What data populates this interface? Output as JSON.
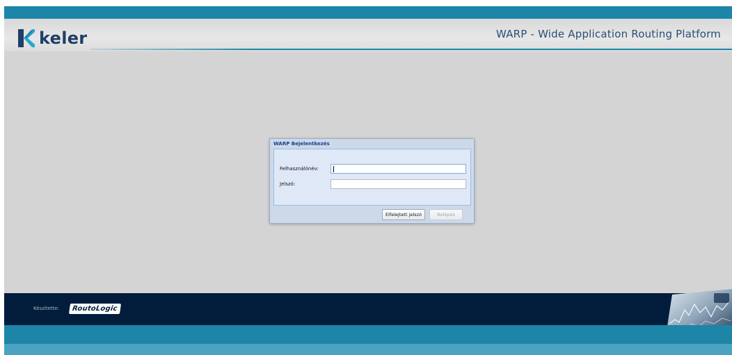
{
  "header": {
    "brand_name": "keler",
    "logo_icon": "keler-k-logo-icon",
    "app_title": "WARP - Wide Application Routing Platform"
  },
  "login_dialog": {
    "title": "WARP Bejelentkezés",
    "username_label": "Felhasználónév:",
    "username_value": "",
    "password_label": "Jelszó:",
    "password_value": "",
    "forgot_password_button": "Elfelejtett jelszó",
    "login_button": "Belépés"
  },
  "footer": {
    "made_by_label": "Készítette:",
    "company_logo_text": "RoutoLogic",
    "decoration": "stock-chart-image"
  },
  "colors": {
    "brand_teal": "#1d86a8",
    "footer_navy": "#021d3c",
    "page_grey": "#d4d4d4",
    "dialog_blue": "#dfe8f6",
    "title_blue": "#15428b"
  }
}
